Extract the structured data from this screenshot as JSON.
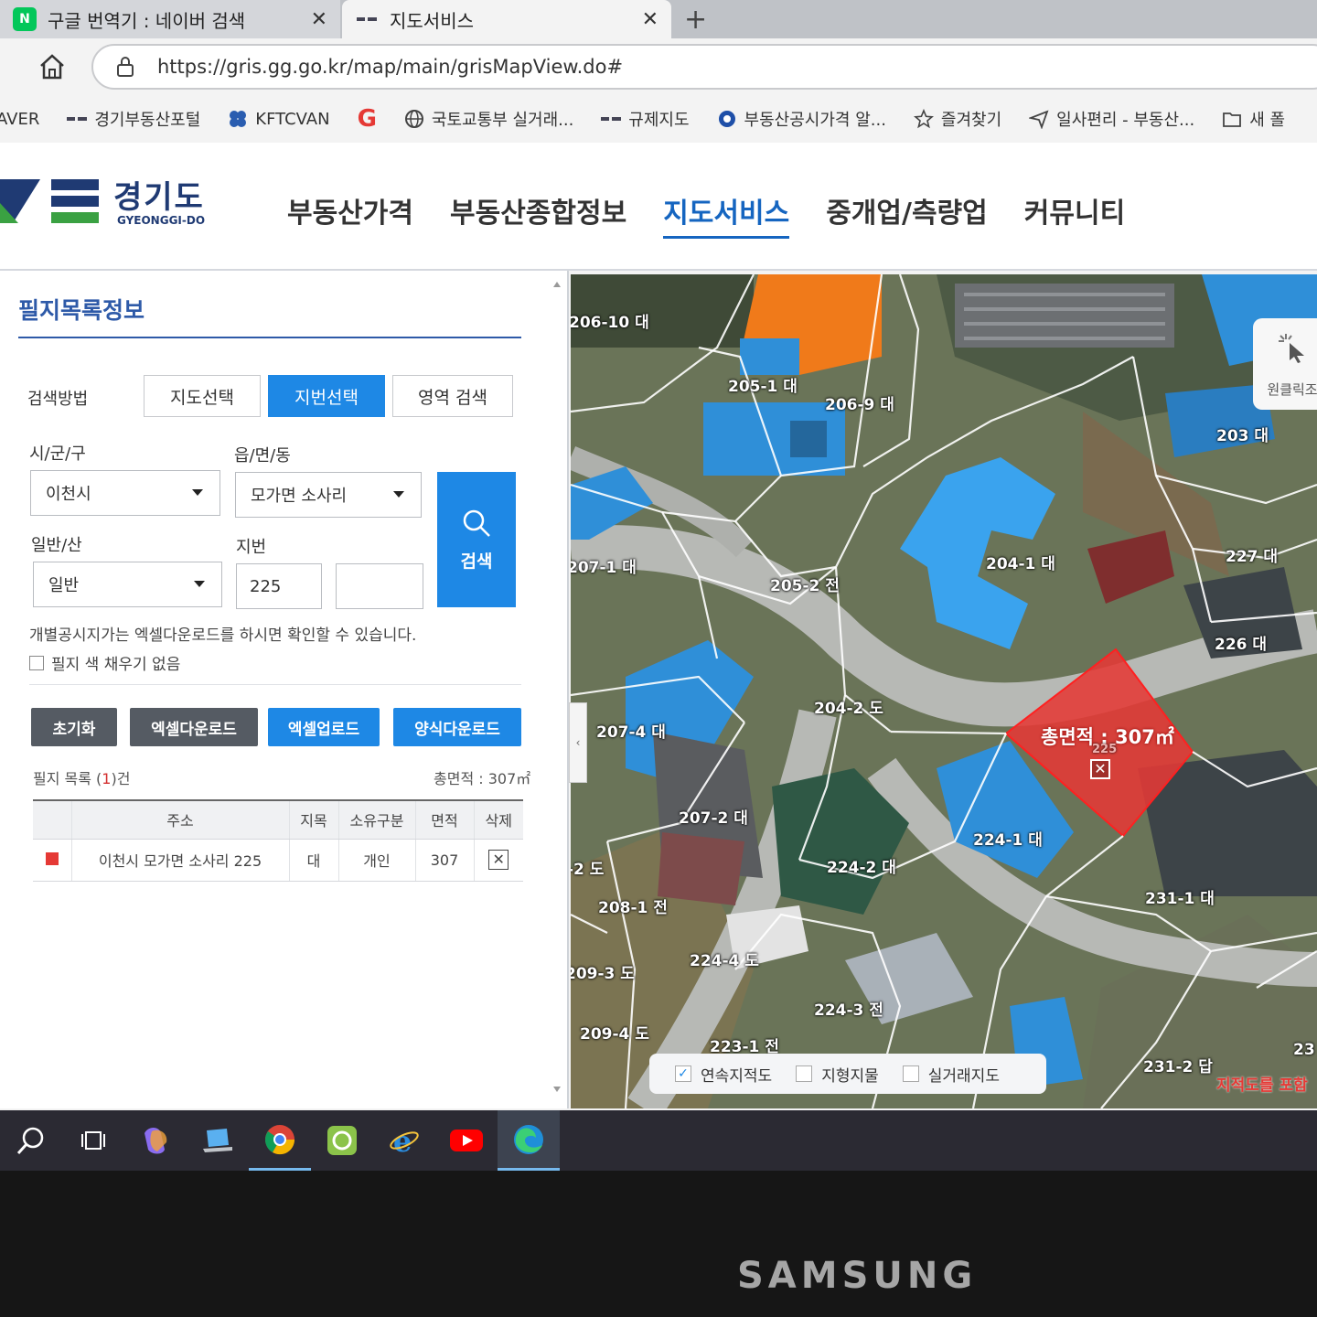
{
  "browser": {
    "tabs": [
      {
        "label": "구글 번역기 : 네이버 검색",
        "favicon": "N",
        "close": "✕"
      },
      {
        "label": "지도서비스",
        "close": "✕"
      }
    ],
    "new_tab": "+",
    "url": "https://gris.gg.go.kr/map/main/grisMapView.do#",
    "bookmarks": [
      "AVER",
      "경기부동산포털",
      "KFTCVAN",
      "G",
      "국토교통부 실거래...",
      "규제지도",
      "부동산공시가격 알...",
      "즐겨찾기",
      "일사편리 - 부동산...",
      "새 폴"
    ]
  },
  "site": {
    "logo_ko": "경기도",
    "logo_en": "GYEONGGI-DO",
    "nav": [
      "부동산가격",
      "부동산종합정보",
      "지도서비스",
      "중개업/측량업",
      "커뮤니티"
    ],
    "nav_active_index": 2
  },
  "panel": {
    "title": "필지목록정보",
    "search_method_label": "검색방법",
    "search_methods": [
      "지도선택",
      "지번선택",
      "영역 검색"
    ],
    "selected_method_index": 1,
    "sigungu_label": "시/군/구",
    "sigungu_value": "이천시",
    "dong_label": "읍/면/동",
    "dong_value": "모가면 소사리",
    "type_label": "일반/산",
    "type_value": "일반",
    "jibun_label": "지번",
    "jibun_main": "225",
    "jibun_sub": "",
    "search_button": "검색",
    "notice": "개별공시지가는 엑셀다운로드를 하시면 확인할 수 있습니다.",
    "no_fill_label": "필지 색 채우기 없음",
    "no_fill_checked": false,
    "buttons": {
      "reset": "초기화",
      "excel_download": "엑셀다운로드",
      "excel_upload": "엑셀업로드",
      "form_download": "양식다운로드"
    },
    "list_count_prefix": "필지 목록 (",
    "list_count": "1",
    "list_count_suffix": ")건",
    "total_area": "총면적 : 307㎡",
    "table": {
      "headers": [
        "",
        "주소",
        "지목",
        "소유구분",
        "면적",
        "삭제"
      ],
      "rows": [
        {
          "address": "이천시 모가면 소사리 225",
          "jimok": "대",
          "owner": "개인",
          "area": "307",
          "delete": "✕"
        }
      ]
    }
  },
  "map": {
    "parcel_labels": [
      "206-10 대",
      "205-1 대",
      "206-9 대",
      "203 대",
      "207-1 대",
      "205-2 전",
      "204-1 대",
      "227 대",
      "226 대",
      "204-2 도",
      "207-4 대",
      "207-2 대",
      "224-1 대",
      "224-2 대",
      "231-1 대",
      "-2 도",
      "208-1 전",
      "224-4 도",
      "209-3 도",
      "224-3 전",
      "209-4 도",
      "223-1 전",
      "231-2 답",
      "23"
    ],
    "selected_area": "총면적 : 307㎡",
    "selected_parcel_no": "225",
    "selected_close": "✕",
    "round_capture": "원클릭조",
    "layers": [
      {
        "label": "연속지적도",
        "checked": true
      },
      {
        "label": "지형지물",
        "checked": false
      },
      {
        "label": "실거래지도",
        "checked": false
      }
    ],
    "hint": "지적도를 포함",
    "collapse_arrow": "‹",
    "colors": {
      "selected": "#e53935",
      "roof_blue": "#2f8fd8",
      "roof_orange": "#f07a1a",
      "boundary": "#ffffff"
    }
  },
  "taskbar": {
    "icons": [
      "search-icon",
      "task-view-icon",
      "copilot-icon",
      "laptop-icon",
      "chrome-icon",
      "green-app-icon",
      "ie-icon",
      "youtube-icon",
      "edge-icon"
    ],
    "active_index": 8
  },
  "device": {
    "brand": "SAMSUNG"
  }
}
